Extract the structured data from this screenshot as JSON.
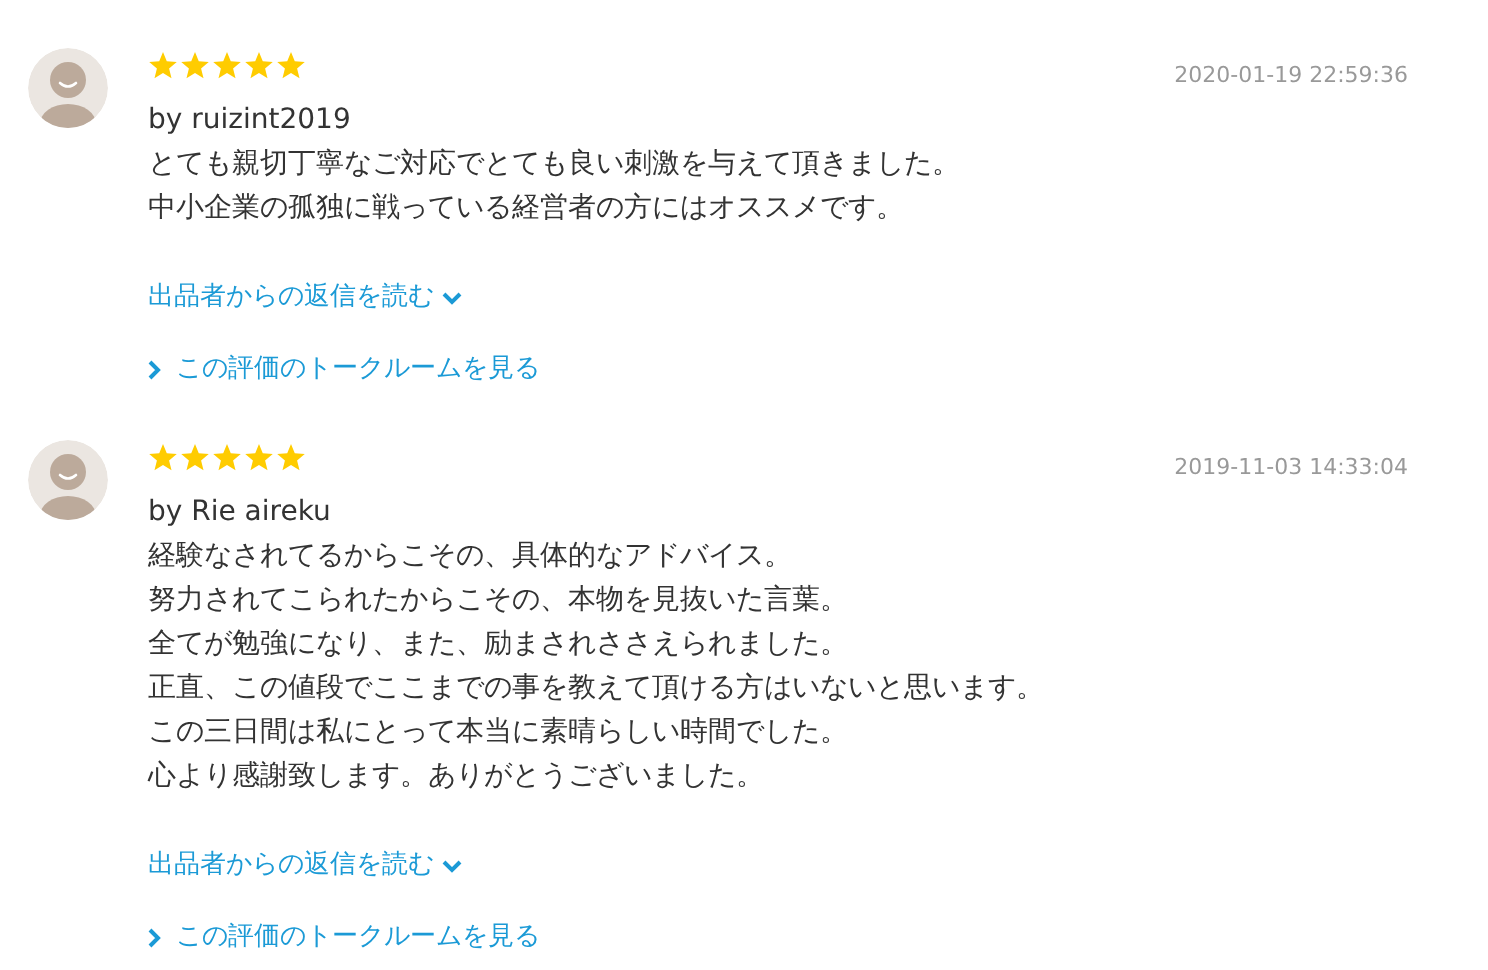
{
  "reviews": [
    {
      "stars": 5,
      "date": "2020-01-19 22:59:36",
      "author": "by ruizint2019",
      "lines": [
        "とても親切丁寧なご対応でとても良い刺激を与えて頂きました。",
        "中小企業の孤独に戦っている経営者の方にはオススメです。"
      ],
      "reply_link": "出品者からの返信を読む",
      "talkroom_link": "この評価のトークルームを見る"
    },
    {
      "stars": 5,
      "date": "2019-11-03 14:33:04",
      "author": "by Rie aireku",
      "lines": [
        "経験なされてるからこその、具体的なアドバイス。",
        "努力されてこられたからこその、本物を見抜いた言葉。",
        "全てが勉強になり、また、励まされささえられました。",
        "正直、この値段でここまでの事を教えて頂ける方はいないと思います。",
        "この三日間は私にとって本当に素晴らしい時間でした。",
        "心より感謝致します。ありがとうございました。"
      ],
      "reply_link": "出品者からの返信を読む",
      "talkroom_link": "この評価のトークルームを見る"
    }
  ]
}
